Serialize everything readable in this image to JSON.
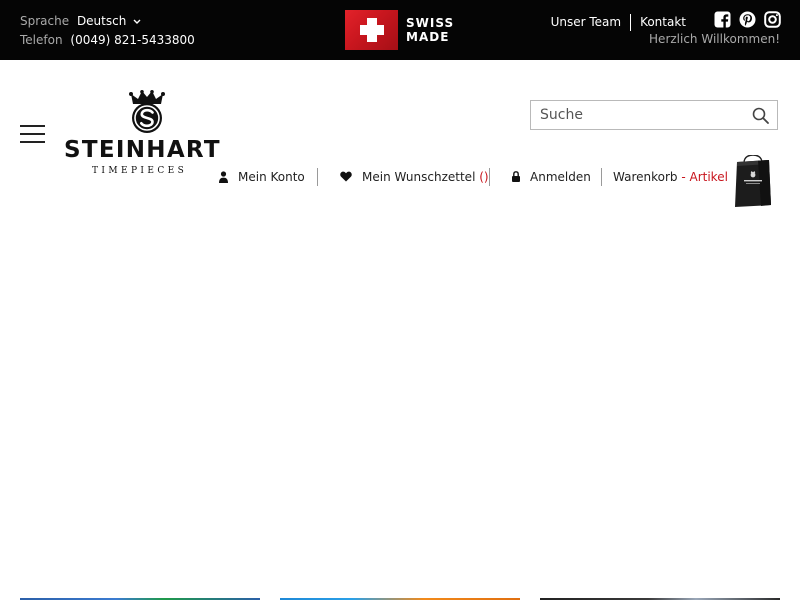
{
  "topbar": {
    "language_label": "Sprache",
    "language_value": "Deutsch",
    "phone_label": "Telefon",
    "phone_value": "(0049) 821-5433800",
    "swiss_line1": "SWISS",
    "swiss_line2": "MADE",
    "links": {
      "team": "Unser Team",
      "contact": "Kontakt"
    },
    "socials": [
      "facebook-icon",
      "pinterest-icon",
      "instagram-icon"
    ],
    "welcome": "Herzlich Willkommen!"
  },
  "brand": {
    "name": "STEINHART",
    "tagline": "TIMEPIECES"
  },
  "search": {
    "placeholder": "Suche"
  },
  "nav": {
    "account": "Mein Konto",
    "wishlist": "Mein Wunschzettel",
    "wishlist_count": "()",
    "login": "Anmelden",
    "cart": "Warenkorb",
    "cart_suffix": " - Artikel"
  },
  "colors": {
    "topbar_bg": "#050505",
    "accent": "#c8161e",
    "swiss_red": "#e3222a"
  }
}
